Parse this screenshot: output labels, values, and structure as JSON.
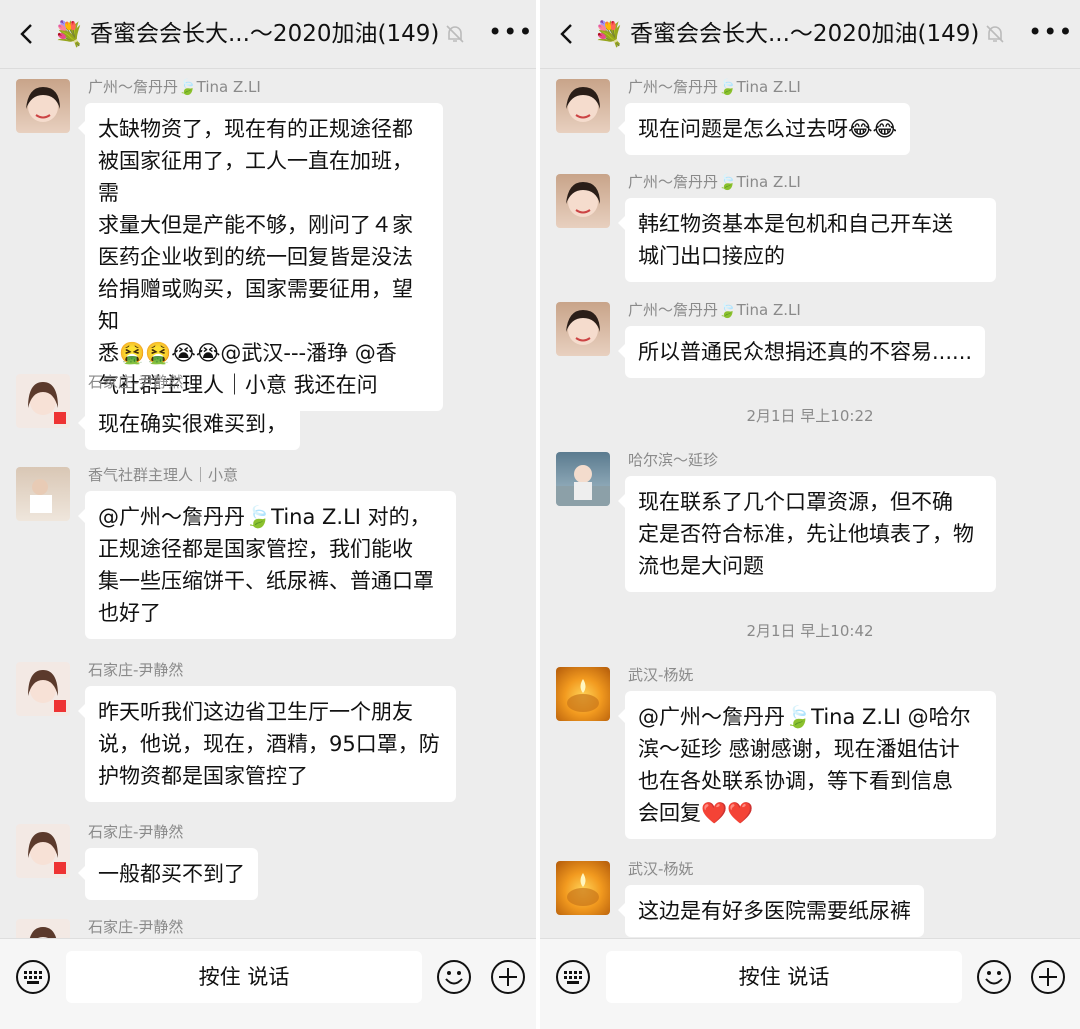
{
  "left": {
    "title": "香蜜会会长大...～2020加油(149)",
    "talk_label": "按住 说话",
    "messages": [
      {
        "sender": "广州～詹丹丹🍃Tina Z.LI",
        "lines": [
          "太缺物资了，现在有的正规途径都",
          "被国家征用了，工人一直在加班，需",
          "求量大但是产能不够，刚问了４家",
          "医药企业收到的统一回复皆是没法",
          "给捐赠或购买，国家需要征用，望知",
          "悉🤮🤮😭😭@武汉---潘琤 @香",
          "气社群主理人｜小意  我还在问"
        ]
      },
      {
        "sender": "石家庄-尹静然",
        "lines": [
          "现在确实很难买到，"
        ]
      },
      {
        "sender": "香气社群主理人｜小意",
        "lines": [
          "@广州～詹丹丹🍃Tina Z.LI 对的，",
          "正规途径都是国家管控，我们能收",
          "集一些压缩饼干、纸尿裤、普通口罩",
          "也好了"
        ]
      },
      {
        "sender": "石家庄-尹静然",
        "lines": [
          "昨天听我们这边省卫生厅一个朋友",
          "说，他说，现在，酒精，95口罩，防",
          "护物资都是国家管控了"
        ]
      },
      {
        "sender": "石家庄-尹静然",
        "lines": [
          "一般都买不到了"
        ]
      },
      {
        "sender": "石家庄-尹静然",
        "lines": []
      }
    ]
  },
  "right": {
    "title": "香蜜会会长大...～2020加油(149)",
    "talk_label": "按住 说话",
    "time1": "2月1日 早上10:22",
    "time2": "2月1日 早上10:42",
    "messages": [
      {
        "sender": "广州～詹丹丹🍃Tina Z.LI",
        "lines": [
          "现在问题是怎么过去呀😂😂"
        ]
      },
      {
        "sender": "广州～詹丹丹🍃Tina Z.LI",
        "lines": [
          "韩红物资基本是包机和自己开车送",
          "城门出口接应的"
        ]
      },
      {
        "sender": "广州～詹丹丹🍃Tina Z.LI",
        "lines": [
          "所以普通民众想捐还真的不容易......"
        ]
      },
      {
        "sender": "哈尔滨～延珍",
        "lines": [
          "现在联系了几个口罩资源，但不确",
          "定是否符合标准，先让他填表了，物",
          "流也是大问题"
        ]
      },
      {
        "sender": "武汉-杨妩",
        "lines": [
          "@广州～詹丹丹🍃Tina Z.LI @哈尔",
          "滨～延珍  感谢感谢，现在潘姐估计",
          "也在各处联系协调，等下看到信息",
          "会回复❤️❤️"
        ]
      },
      {
        "sender": "武汉-杨妩",
        "lines": [
          "这边是有好多医院需要纸尿裤"
        ]
      }
    ]
  },
  "colors": {
    "background": "#ededed",
    "bubble": "#ffffff",
    "name": "#8a8a8a",
    "mention": "#3b6fb6"
  },
  "icons": [
    "back-arrow-icon",
    "flower-emoji-icon",
    "mute-bell-icon",
    "more-icon",
    "keyboard-icon",
    "emoji-icon",
    "plus-icon"
  ]
}
